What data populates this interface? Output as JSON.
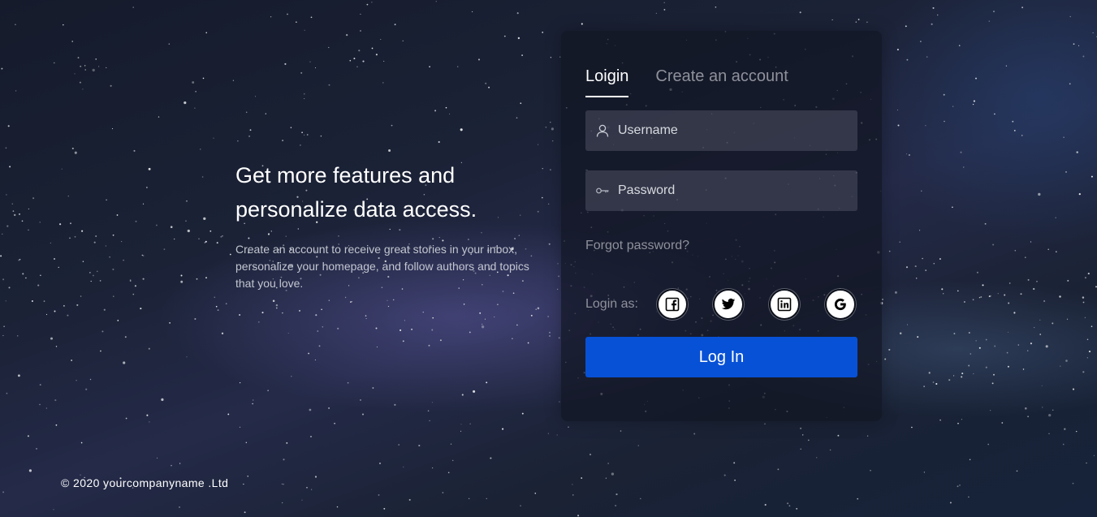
{
  "promo": {
    "title_line1": "Get more features and",
    "title_line2": "personalize data access.",
    "description": "Create an account to receive great stories in your inbox, personalize your homepage, and follow authors and topics that you love."
  },
  "auth": {
    "tabs": [
      {
        "label": "Loigin",
        "active": true
      },
      {
        "label": "Create an account",
        "active": false
      }
    ],
    "username": {
      "placeholder": "Username",
      "icon": "user-icon"
    },
    "password": {
      "placeholder": "Password",
      "icon": "key-icon"
    },
    "forgot_label": "Forgot password?",
    "login_as_label": "Login as:",
    "social": [
      {
        "name": "facebook",
        "icon": "facebook-icon"
      },
      {
        "name": "twitter",
        "icon": "twitter-icon"
      },
      {
        "name": "linkedin",
        "icon": "linkedin-icon"
      },
      {
        "name": "google",
        "icon": "google-icon"
      }
    ],
    "submit_label": "Log In"
  },
  "footer": {
    "copyright": "© 2020 yourcompanyname .Ltd"
  },
  "colors": {
    "accent": "#0751d6",
    "muted_text": "#8e919b",
    "card_bg": "#121624"
  }
}
